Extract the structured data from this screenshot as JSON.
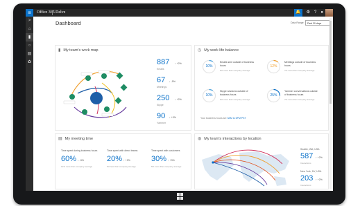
{
  "topbar": {
    "app_name": "Office 365",
    "app_sub": "Delve",
    "waffle": "≡"
  },
  "nav_icons": [
    "arrow-left-icon",
    "home-icon",
    "chart-icon",
    "circle-icon",
    "calendar-icon",
    "network-icon"
  ],
  "header": {
    "title": "Dashboard",
    "select_label": "Data Range",
    "select_value": "Past 30 days"
  },
  "work_map": {
    "title": "My team's work map",
    "metrics": [
      {
        "value": "887",
        "delta": "↑ +2%",
        "label": "Emails"
      },
      {
        "value": "67",
        "delta": "↓ -5%",
        "label": "Meetings"
      },
      {
        "value": "250",
        "delta": "↑ +2%",
        "label": "Skype"
      },
      {
        "value": "90",
        "delta": "↑ +3%",
        "label": "Yammer"
      }
    ]
  },
  "balance": {
    "title": "My work life balance",
    "items": [
      {
        "pct": "10%",
        "title": "Emails sent outside of business hours",
        "sub": "5% more than company average",
        "color": "#4aa3df"
      },
      {
        "pct": "12%",
        "title": "Meetings outside of business hours",
        "sub": "7% more than company average",
        "color": "#f0a030"
      },
      {
        "pct": "10%",
        "title": "Skype sessions outside of business hours",
        "sub": "5% more than company average",
        "color": "#4aa3df"
      },
      {
        "pct": "25%",
        "title": "Yammer conversations outside of business hours",
        "sub": "7% more than company average",
        "color": "#0a71c9"
      }
    ],
    "footer_prefix": "Your business hours are",
    "footer_link": "9AM to 6PM PST"
  },
  "meeting_time": {
    "title": "My meeting time",
    "items": [
      {
        "label": "Time spent during business hours",
        "pct": "60%",
        "delta": "↓ -3%",
        "sub": "12% more than company average"
      },
      {
        "label": "Time spent with direct teams",
        "pct": "20%",
        "delta": "↑ +2%",
        "sub": "6% less than company average"
      },
      {
        "label": "Time spent with customers",
        "pct": "30%",
        "delta": "↑ +3%",
        "sub": "5% more than company average"
      }
    ]
  },
  "interactions": {
    "title": "My team's interactions by location",
    "locations": [
      {
        "label": "Seattle, WA, USA",
        "value": "587",
        "delta": "↑ +2%",
        "sub": "Interactions"
      },
      {
        "label": "New York, NY, USA",
        "value": "203",
        "delta": "↑ +2%",
        "sub": "Interactions"
      }
    ]
  },
  "colors": {
    "accent": "#0a71c9",
    "topbar": "#262626",
    "nav": "#2d2d2d",
    "node_green": "#1e8c63",
    "node_blue": "#1f5fa8"
  }
}
